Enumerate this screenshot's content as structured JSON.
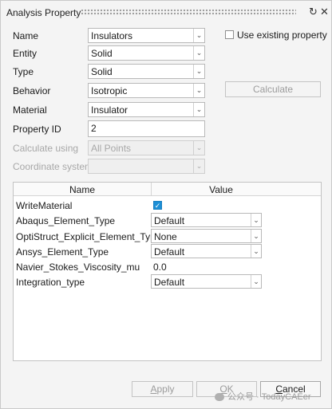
{
  "titlebar": {
    "title": "Analysis Property",
    "refresh_icon": "refresh-icon",
    "close_icon": "close-icon"
  },
  "form": {
    "name_label": "Name",
    "name_value": "Insulators",
    "entity_label": "Entity",
    "entity_value": "Solid",
    "type_label": "Type",
    "type_value": "Solid",
    "behavior_label": "Behavior",
    "behavior_value": "Isotropic",
    "material_label": "Material",
    "material_value": "Insulator",
    "property_id_label": "Property ID",
    "property_id_value": "2",
    "calculate_using_label": "Calculate using",
    "calculate_using_value": "All Points",
    "coordinate_system_label": "Coordinate system",
    "coordinate_system_value": ""
  },
  "use_existing": {
    "label": "Use existing property",
    "checked": false
  },
  "calculate_button": "Calculate",
  "table": {
    "headers": [
      "Name",
      "Value"
    ],
    "rows": [
      {
        "name": "WriteMaterial",
        "kind": "checkbox",
        "value": "checked"
      },
      {
        "name": "Abaqus_Element_Type",
        "kind": "combo",
        "value": "Default"
      },
      {
        "name": "OptiStruct_Explicit_Element_Type",
        "kind": "combo",
        "value": "None"
      },
      {
        "name": "Ansys_Element_Type",
        "kind": "combo",
        "value": "Default"
      },
      {
        "name": "Navier_Stokes_Viscosity_mu",
        "kind": "text",
        "value": "0.0"
      },
      {
        "name": "Integration_type",
        "kind": "combo",
        "value": "Default"
      }
    ]
  },
  "buttons": {
    "apply_first": "A",
    "apply_rest": "pply",
    "ok_first": "O",
    "ok_rest": "K",
    "cancel_first": "C",
    "cancel_rest": "ancel"
  },
  "watermark": "公众号 · TodayCAEer",
  "colors": {
    "accent": "#1c8fd6",
    "panel_bg": "#f4f4f4",
    "disabled_text": "#a8a8a8"
  }
}
